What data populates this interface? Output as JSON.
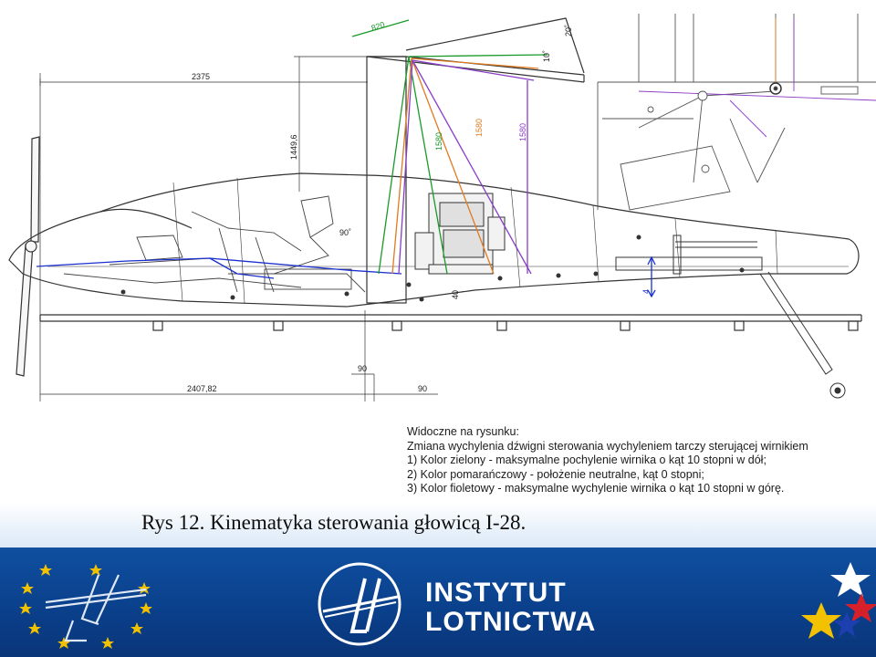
{
  "drawing": {
    "dimensions": {
      "top_length": "2375",
      "mast_height": "1449,6",
      "bottom_length": "2407,82",
      "offset_90_a": "90",
      "offset_90_b": "90",
      "green_horizontal": "820",
      "angle_20": "20˚",
      "angle_10": "10˚",
      "green_vertical": "1580",
      "orange_vertical": "1580",
      "violet_vertical": "1580",
      "angle_90": "90˚",
      "small_4": "4",
      "small_40": "40"
    },
    "colors": {
      "green": "#1a9a2a",
      "orange": "#e07a20",
      "violet": "#8a3cc8",
      "blue": "#1a2fd0",
      "line": "#333333"
    }
  },
  "legend": {
    "heading": "Widoczne na rysunku:",
    "line1": "Zmiana wychylenia dźwigni sterowania wychyleniem tarczy sterującej wirnikiem",
    "line2": "1) Kolor zielony - maksymalne pochylenie wirnika o kąt 10 stopni w dół;",
    "line3": "2) Kolor pomarańczowy - położenie neutralne, kąt 0 stopni;",
    "line4": "3) Kolor fioletowy - maksymalne wychylenie wirnika o kąt 10 stopni w górę."
  },
  "caption": "Rys 12. Kinematyka sterowania głowicą I-28.",
  "footer": {
    "brand_line1": "INSTYTUT",
    "brand_line2": "LOTNICTWA",
    "colors": {
      "band": "#0f4fa0",
      "star": "#f2c200",
      "flag_white": "#ffffff",
      "flag_red": "#d8202a",
      "flag_blue": "#1e3fb0",
      "flag_yellow": "#f2c200"
    }
  }
}
